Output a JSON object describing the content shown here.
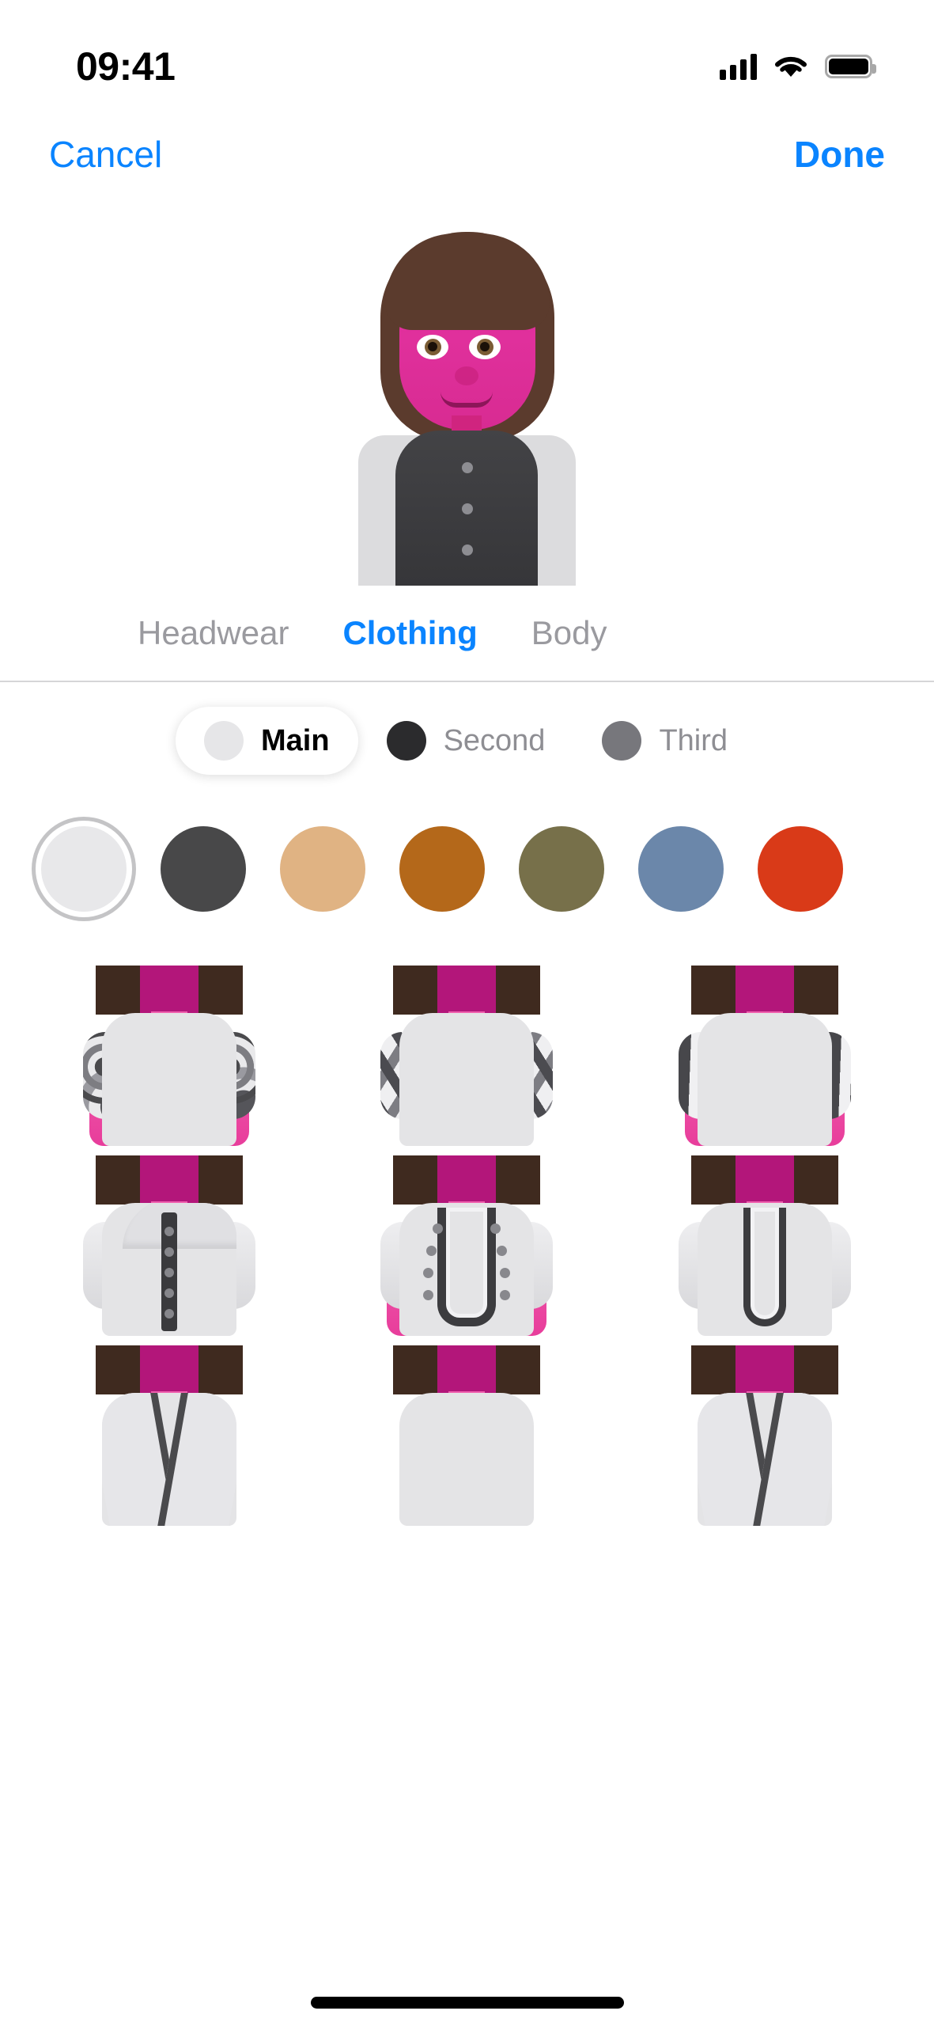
{
  "status_bar": {
    "time": "09:41",
    "signal_icon": "cellular-signal-icon",
    "wifi_icon": "wifi-icon",
    "battery_icon": "battery-icon"
  },
  "nav": {
    "cancel_label": "Cancel",
    "done_label": "Done"
  },
  "avatar_preview": {
    "description": "memoji-avatar-preview",
    "skin_color": "#e0309c",
    "hair_color": "#5b3b2d",
    "vest_color": "#3c3c3f",
    "sleeve_color": "#dcdcde",
    "side_preview_left": "memoji-side-preview-left",
    "side_preview_right": "memoji-side-preview-right"
  },
  "tabs": [
    {
      "label": "Headwear",
      "selected": false
    },
    {
      "label": "Clothing",
      "selected": true
    },
    {
      "label": "Body",
      "selected": false
    }
  ],
  "layer_picker": [
    {
      "label": "Main",
      "color": "#e6e6e8",
      "selected": true
    },
    {
      "label": "Second",
      "color": "#2b2b2d",
      "selected": false
    },
    {
      "label": "Third",
      "color": "#77777c",
      "selected": false
    }
  ],
  "color_swatches": [
    {
      "name": "white",
      "color": "#e8e8ea",
      "selected": true
    },
    {
      "name": "charcoal",
      "color": "#484849",
      "selected": false
    },
    {
      "name": "tan",
      "color": "#e0b383",
      "selected": false
    },
    {
      "name": "rust",
      "color": "#b4681a",
      "selected": false
    },
    {
      "name": "olive",
      "color": "#77704a",
      "selected": false
    },
    {
      "name": "steel-blue",
      "color": "#6b87aa",
      "selected": false
    },
    {
      "name": "red",
      "color": "#d93a18",
      "selected": false
    }
  ],
  "clothing_grid": [
    {
      "name": "swirl-print-dress",
      "pattern": "swirl",
      "selected": false
    },
    {
      "name": "lattice-print-top",
      "pattern": "lattice",
      "selected": false
    },
    {
      "name": "vertical-stripe-top",
      "pattern": "stripe",
      "selected": false
    },
    {
      "name": "zip-hoodie",
      "pattern": "hoodie",
      "selected": false
    },
    {
      "name": "embroidered-tunic",
      "pattern": "studded",
      "selected": false
    },
    {
      "name": "kurta-placket-tunic",
      "pattern": "placket",
      "selected": false
    },
    {
      "name": "wrap-robe-left",
      "pattern": "robe",
      "selected": false
    },
    {
      "name": "wrap-robe-center",
      "pattern": "robe",
      "selected": false
    },
    {
      "name": "wrap-robe-right",
      "pattern": "robe",
      "selected": false
    }
  ],
  "theme": {
    "accent": "#0a84ff",
    "inactive_text": "#9a9a9f",
    "background": "#ffffff",
    "divider": "#d6d6d8"
  },
  "home_indicator": "home-indicator"
}
